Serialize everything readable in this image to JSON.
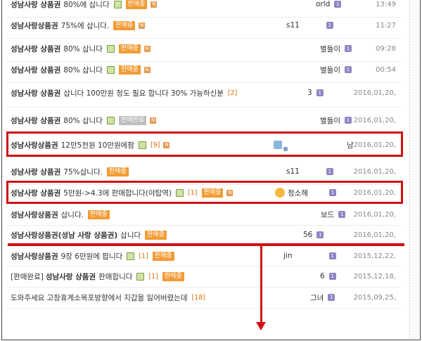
{
  "rows": [
    {
      "bold": "성남사랑 상품권",
      "title": " 80%에 삽니다",
      "badge": "판매중",
      "badge_gray": false,
      "new": "N",
      "author": "orld",
      "lv": "1",
      "date": "13:49"
    },
    {
      "bold": "성남사랑상품권",
      "title": " 75%에 삽니다.",
      "badge": "판매중",
      "badge_gray": false,
      "new": "N",
      "author": "s11",
      "lv": "1",
      "date": "11:27"
    },
    {
      "bold": "성남사랑 상품권",
      "title": " 80% 삽니다",
      "badge": "판매중",
      "badge_gray": false,
      "new": "N",
      "author": "별들이",
      "lv": "1",
      "date": "09:28"
    },
    {
      "bold": "성남사랑 상품권",
      "title": " 80% 삽니다",
      "badge": "판매중",
      "badge_gray": false,
      "new": "N",
      "author": "별들이",
      "lv": "1",
      "date": "00:54"
    },
    {
      "bold": "성남사랑 상품권",
      "title": " 삽니다 100만원 정도 필요 합니다 30% 가능하신분",
      "count": "[2]",
      "author": "3",
      "lv": "1",
      "date": "2016,01,20,"
    },
    {
      "bold": "성남사랑 상품권",
      "title": " 80% 삽니다",
      "badge": "판매완료",
      "badge_gray": true,
      "new": "N",
      "author": "별들이",
      "lv": "1",
      "date": "2016,01,20,"
    },
    {
      "bold": "성남사랑상품권",
      "title": " 12만5천원 10만원에팜",
      "count": "[9]",
      "new": "N",
      "author": "남",
      "lv": "",
      "date": "2016,01,20,"
    },
    {
      "bold": "성남사랑 상품권",
      "title": " 75%삽니다.",
      "badge": "판매중",
      "badge_gray": false,
      "author": "s11",
      "lv": "1",
      "date": "2016,01,20,"
    },
    {
      "bold": "성남사랑 상품권",
      "title": " 5만원->4.3에 판매합니다(야탑역)",
      "count": "[1]",
      "badge": "판매중",
      "badge_gray": false,
      "new": "N",
      "author": "청소해",
      "lv": "1",
      "date": "2016,01,20,"
    },
    {
      "bold": "성남사랑상품권",
      "title": " 삽니다.",
      "badge": "판매중",
      "badge_gray": false,
      "author": "보드",
      "lv": "1",
      "date": "2016,01,20,"
    },
    {
      "bold": "성남사랑상품권(성남 사랑 상품권)",
      "title": " 삽니다",
      "badge": "판매중",
      "badge_gray": false,
      "author": "56",
      "lv": "1",
      "date": "2016,01,20,"
    },
    {
      "bold": "성남사랑상품권",
      "title": " 9장 6만원에 팝니다",
      "count": "[1]",
      "badge": "판매중",
      "badge_gray": false,
      "author": "jin",
      "lv": "1",
      "date": "2015,12,22,"
    },
    {
      "prefix": "[판매완료]",
      "bold": "성남사랑 상품권",
      "title": " 판매합니다",
      "count": "[1]",
      "badge": "판매중",
      "badge_gray": false,
      "author": "6",
      "lv": "1",
      "date": "2015,12,18,"
    },
    {
      "title": "도와주세요 고창휴게소목포방향에서 지갑을 잃어버렸는데",
      "count": "[18]",
      "author": "그녀",
      "lv": "1",
      "date": "2015,09,25,"
    }
  ]
}
